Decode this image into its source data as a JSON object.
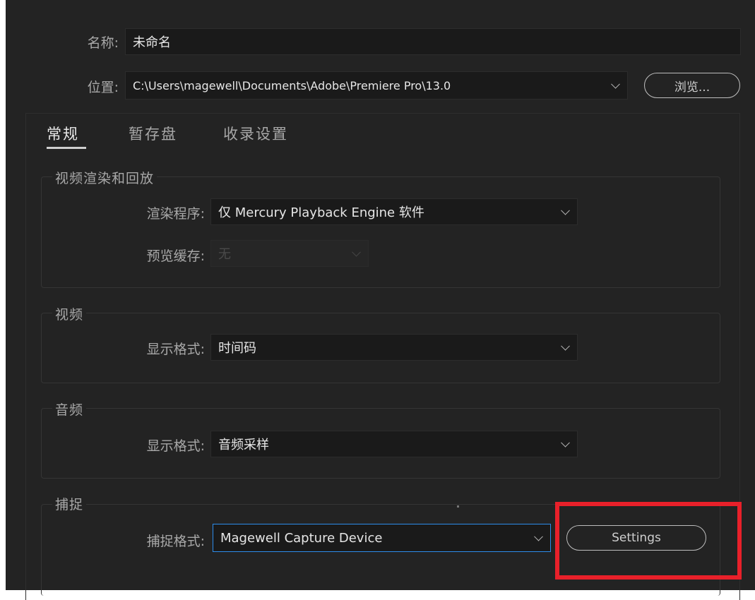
{
  "name": {
    "label": "名称:",
    "value": "未命名"
  },
  "location": {
    "label": "位置:",
    "value": "C:\\Users\\magewell\\Documents\\Adobe\\Premiere Pro\\13.0",
    "browse_label": "浏览..."
  },
  "tabs": [
    {
      "label": "常规",
      "active": true
    },
    {
      "label": "暂存盘",
      "active": false
    },
    {
      "label": "收录设置",
      "active": false
    }
  ],
  "video_render": {
    "title": "视频渲染和回放",
    "renderer_label": "渲染程序:",
    "renderer_value": "仅 Mercury Playback Engine 软件",
    "preview_cache_label": "预览缓存:",
    "preview_cache_value": "无"
  },
  "video": {
    "title": "视频",
    "display_format_label": "显示格式:",
    "display_format_value": "时间码"
  },
  "audio": {
    "title": "音频",
    "display_format_label": "显示格式:",
    "display_format_value": "音频采样"
  },
  "capture": {
    "title": "捕捉",
    "format_label": "捕捉格式:",
    "format_value": "Magewell Capture Device",
    "settings_label": "Settings"
  },
  "colors": {
    "background": "#232323",
    "field": "#1a1a1a",
    "focus": "#2d8ceb",
    "highlight": "#e8202a"
  }
}
